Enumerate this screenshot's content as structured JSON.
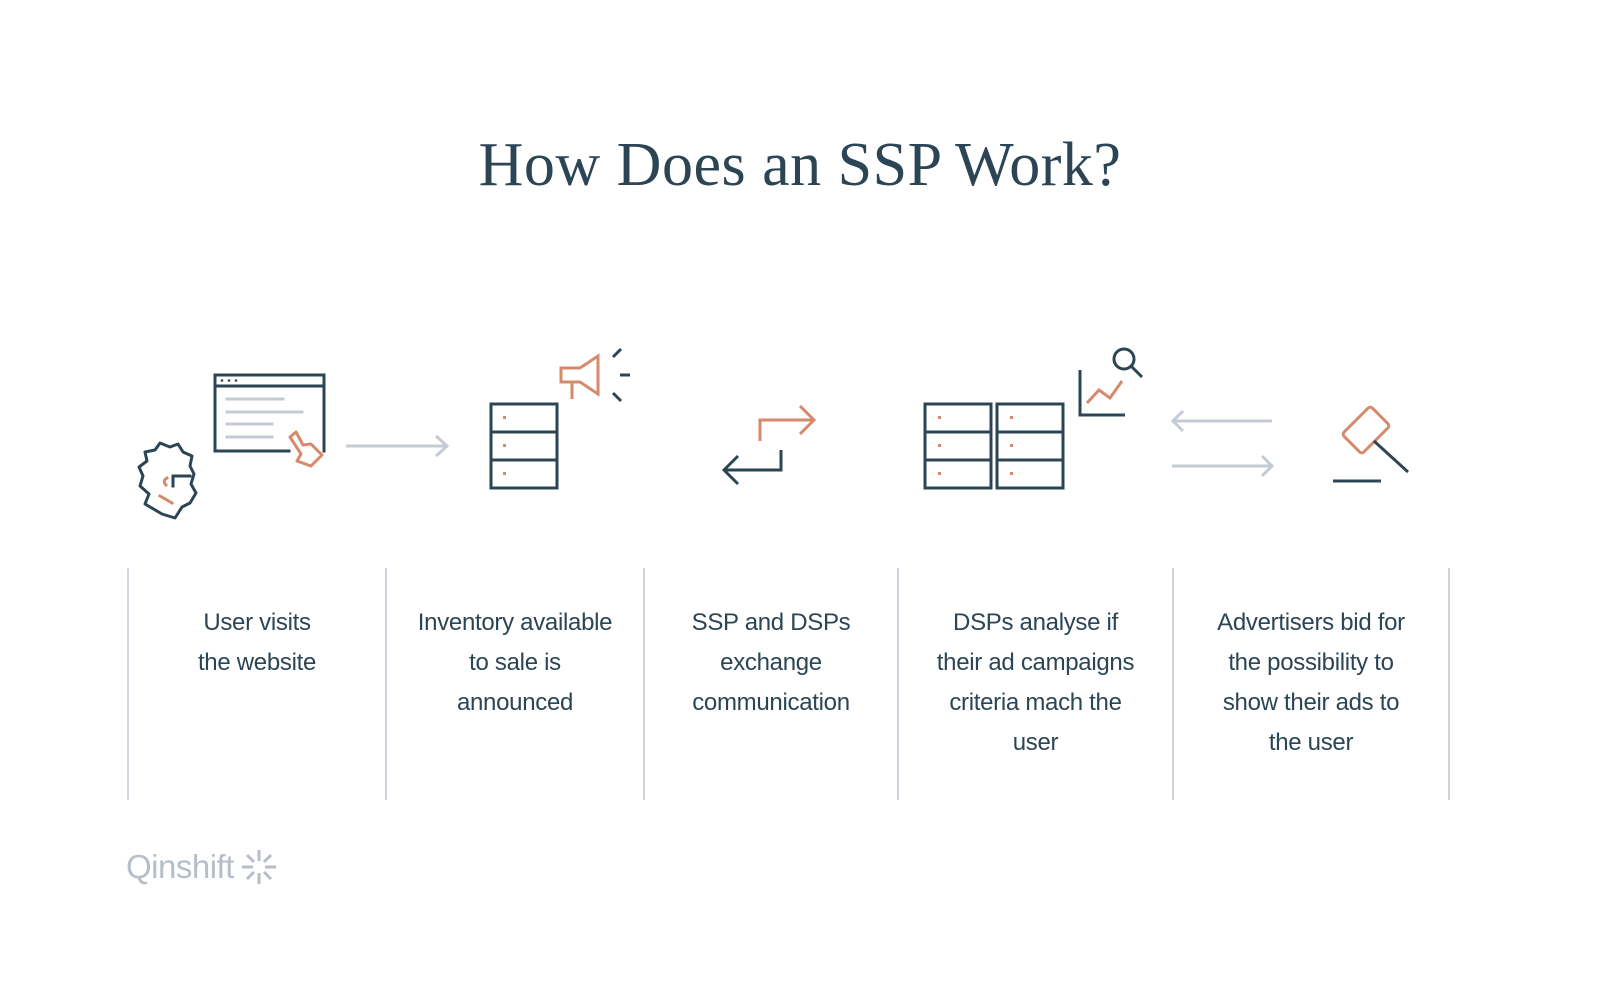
{
  "title": "How Does an SSP Work?",
  "colors": {
    "dark": "#2b4555",
    "accent": "#d68a6c",
    "muted": "#c5cbd5",
    "divider": "#cfd5de"
  },
  "steps": [
    {
      "id": 1,
      "icon": "user-visits-website-icon",
      "text": "User visits\nthe website"
    },
    {
      "id": 2,
      "icon": "inventory-announce-icon",
      "text": "Inventory available\nto sale is\nannounced"
    },
    {
      "id": 3,
      "icon": "exchange-arrows-icon",
      "text": "SSP and DSPs\nexchange\ncommunication"
    },
    {
      "id": 4,
      "icon": "dsp-analysis-icon",
      "text": "DSPs analyse if\ntheir ad campaigns\ncriteria mach the\nuser"
    },
    {
      "id": 5,
      "icon": "auction-gavel-icon",
      "text": "Advertisers bid for\nthe possibility to\nshow their ads to\nthe user"
    }
  ],
  "logo": {
    "text": "Qinshift",
    "icon": "sparkle-icon"
  }
}
